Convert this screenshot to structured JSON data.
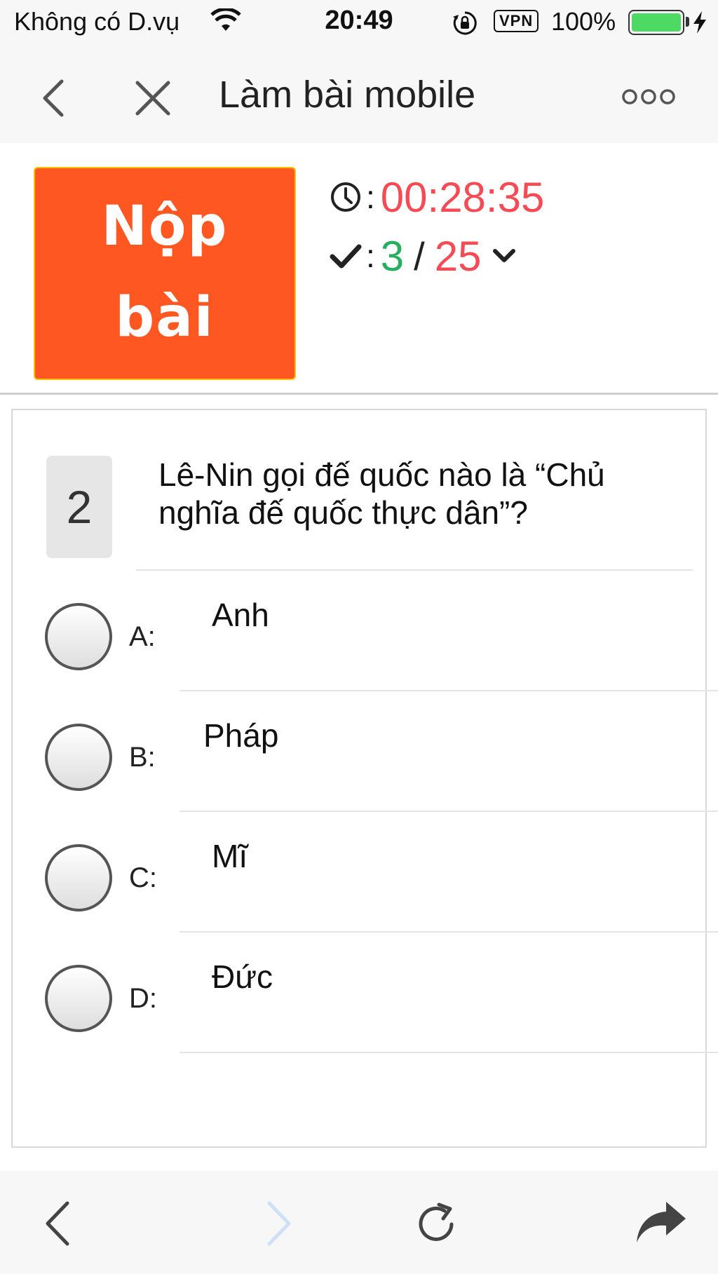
{
  "status_bar": {
    "carrier": "Không có D.vụ",
    "time": "20:49",
    "vpn": "VPN",
    "battery": "100%",
    "battery_level": 1.0
  },
  "nav": {
    "title": "Làm bài mobile",
    "back_icon": "chevron-left-icon",
    "close_icon": "close-icon",
    "more_icon": "more-dots-icon"
  },
  "quiz": {
    "submit_label": "Nộp bài",
    "timer_sep": ":",
    "timer": "00:28:35",
    "progress_sep": ":",
    "answered": "3",
    "slash": "/",
    "total": "25"
  },
  "question": {
    "number": "2",
    "text": "Lê-Nin gọi đế quốc nào là “Chủ nghĩa đế quốc thực dân”?",
    "options": [
      {
        "letter": "A:",
        "text": "Anh"
      },
      {
        "letter": "B:",
        "text": "Pháp"
      },
      {
        "letter": "C:",
        "text": "Mĩ"
      },
      {
        "letter": "D:",
        "text": "Đức"
      }
    ]
  },
  "toolbar": {
    "items": [
      "back-icon",
      "forward-icon",
      "reload-icon",
      "share-icon"
    ]
  },
  "colors": {
    "accent_orange": "#ff5722",
    "button_border": "#ffc107",
    "timer_red": "#f44b54",
    "answered_green": "#27ae60",
    "battery_green": "#4cd964",
    "disabled_blue": "#cfe0f6"
  }
}
